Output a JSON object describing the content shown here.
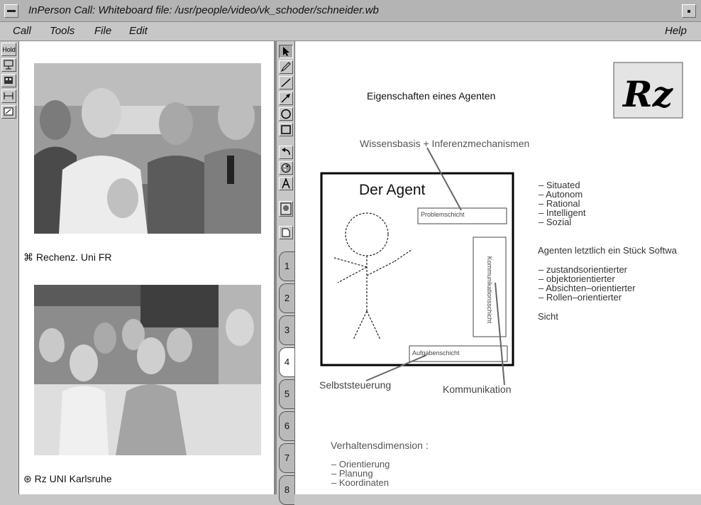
{
  "window": {
    "title": "InPerson Call: Whiteboard file: /usr/people/video/vk_schoder/schneider.wb"
  },
  "menubar": {
    "items": [
      "Call",
      "Tools",
      "File",
      "Edit"
    ],
    "help": "Help"
  },
  "left_toolbar": {
    "hold_label": "Hold"
  },
  "video": {
    "participants": [
      {
        "name": "Rechenz. Uni FR"
      },
      {
        "name": "Rz UNI Karlsruhe"
      }
    ]
  },
  "palette": {
    "pages": [
      "1",
      "2",
      "3",
      "4",
      "5",
      "6",
      "7",
      "8"
    ],
    "active_page": "4"
  },
  "whiteboard": {
    "logo_text": "Rz",
    "heading": "Eigenschaften eines Agenten",
    "label_knowledge": "Wissensbasis + Inferenzmechanismen",
    "agent_title": "Der Agent",
    "problem_layer": "Problemschicht",
    "communication_layer": "Kommunikationsschicht",
    "task_layer": "Aufgabenschicht",
    "label_self_control": "Selbststeuerung",
    "label_communication": "Kommunikation",
    "properties": [
      "– Situated",
      "– Autonom",
      "– Rational",
      "– Intelligent",
      "– Sozial"
    ],
    "software_line": "Agenten letztlich ein Stück Softwa",
    "orientations": [
      "– zustandsorientierter",
      "– objektorientierter",
      "– Absichten–orientierter",
      "– Rollen–orientierter"
    ],
    "view_label": "Sicht",
    "behavior_heading": "Verhaltensdimension :",
    "behavior_items": [
      "– Orientierung",
      "– Planung",
      "– Koordinaten"
    ]
  }
}
